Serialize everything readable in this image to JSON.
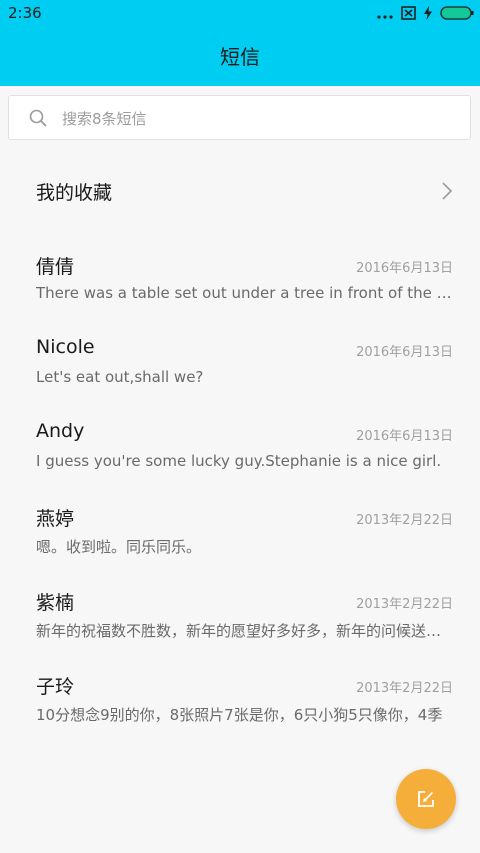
{
  "status": {
    "time": "2:36"
  },
  "header": {
    "title": "短信"
  },
  "search": {
    "placeholder": "搜索8条短信"
  },
  "favorites": {
    "label": "我的收藏"
  },
  "conversations": [
    {
      "name": "倩倩",
      "date": "2016年6月13日",
      "preview": "There was a table set out under a tree in front of the house"
    },
    {
      "name": "Nicole",
      "date": "2016年6月13日",
      "preview": "Let's eat out,shall we?"
    },
    {
      "name": "Andy",
      "date": "2016年6月13日",
      "preview": "I guess you're some lucky guy.Stephanie is a nice girl."
    },
    {
      "name": "燕婷",
      "date": "2013年2月22日",
      "preview": "嗯。收到啦。同乐同乐。"
    },
    {
      "name": "紫楠",
      "date": "2013年2月22日",
      "preview": "新年的祝福数不胜数，新年的愿望好多好多，新年的问候送给你"
    },
    {
      "name": "子玲",
      "date": "2013年2月22日",
      "preview": "10分想念9别的你，8张照片7张是你，6只小狗5只像你，4季"
    }
  ],
  "colors": {
    "accent": "#00cdf2",
    "fab": "#f6ae3b"
  },
  "icons": [
    "search-icon",
    "chevron-right-icon",
    "compose-icon",
    "sim-missing-icon",
    "charging-icon",
    "battery-icon"
  ]
}
